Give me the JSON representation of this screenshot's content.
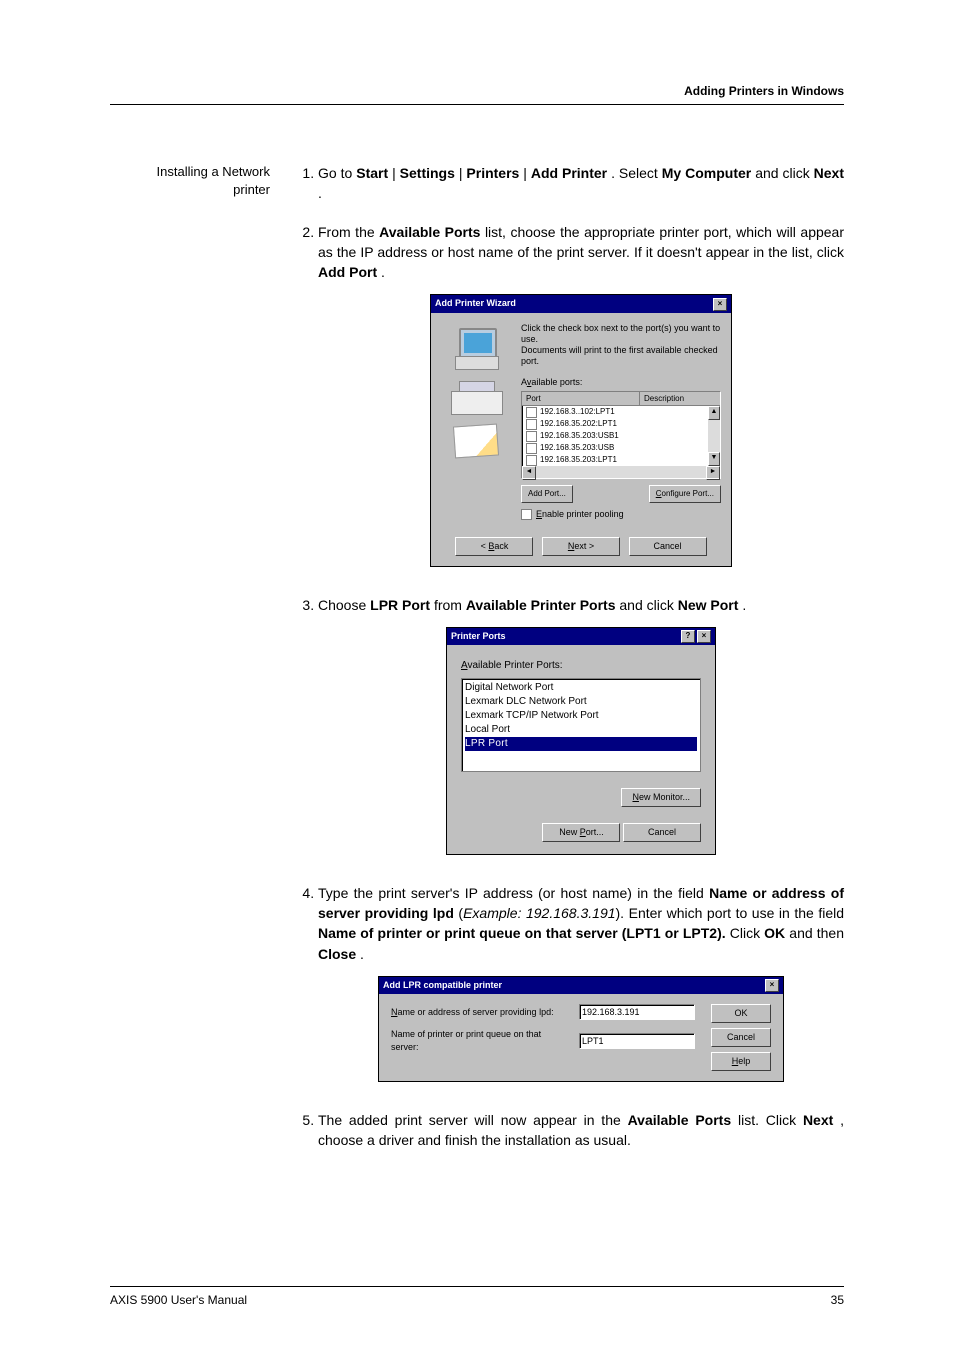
{
  "header": {
    "section_title": "Adding Printers in Windows"
  },
  "side": {
    "heading_line1": "Installing a Network",
    "heading_line2": "printer"
  },
  "steps": {
    "s1": {
      "pre": "Go to ",
      "b1": "Start",
      "sep": " | ",
      "b2": "Settings",
      "b3": "Printers",
      "b4": "Add Printer",
      "mid": ". Select ",
      "b5": "My Computer",
      "mid2": " and click ",
      "b6": "Next",
      "end": "."
    },
    "s2": {
      "pre": "From the ",
      "b1": "Available Ports",
      "mid": " list, choose the appropriate printer port, which will appear as the IP address or host name of the print server. If it doesn't appear in the list, click ",
      "b2": "Add Port",
      "end": "."
    },
    "s3": {
      "pre": "Choose ",
      "b1": "LPR Port",
      "mid": " from ",
      "b2": "Available Printer Ports",
      "mid2": " and click ",
      "b3": "New Port",
      "end": "."
    },
    "s4": {
      "pre": "Type the print server's IP address (or host name) in the field ",
      "b1": "Name or address of server providing lpd",
      "ex_open": " (",
      "ex": "Example: 192.168.3.191",
      "ex_close": "). ",
      "mid": "Enter which port to use in the field ",
      "b2": "Name of printer or print queue on that server (LPT1 or LPT2).",
      "mid2": " Click ",
      "b3": "OK",
      "mid3": " and then ",
      "b4": "Close",
      "end": "."
    },
    "s5": {
      "pre": "The added print server will now appear in the ",
      "b1": "Available Ports",
      "mid": " list. Click ",
      "b2": "Next",
      "end": ", choose a driver and finish the installation as usual."
    }
  },
  "dlg1": {
    "title": "Add Printer Wizard",
    "instr1": "Click the check box next to the port(s) you want to use.",
    "instr2": "Documents will print to the first available checked port.",
    "list_label_pre": "A",
    "list_label_u": "v",
    "list_label_post": "ailable ports:",
    "col_port": "Port",
    "col_desc": "Description",
    "ports": [
      "192.168.3..102:LPT1",
      "192.168.35.202:LPT1",
      "192.168.35.203:USB1",
      "192.168.35.203:USB",
      "192.168.35.203:LPT1"
    ],
    "btn_add": "Add Port...",
    "btn_cfg_pre": "",
    "btn_cfg_u": "C",
    "btn_cfg_post": "onfigure Port...",
    "pool_pre": "",
    "pool_u": "E",
    "pool_post": "nable printer pooling",
    "btn_back_pre": "< ",
    "btn_back_u": "B",
    "btn_back_post": "ack",
    "btn_next_pre": "",
    "btn_next_u": "N",
    "btn_next_post": "ext >",
    "btn_cancel": "Cancel"
  },
  "dlg2": {
    "title": "Printer Ports",
    "label_pre": "",
    "label_u": "A",
    "label_post": "vailable Printer Ports:",
    "items": [
      "Digital Network Port",
      "Lexmark DLC Network Port",
      "Lexmark TCP/IP Network Port",
      "Local Port",
      "LPR Port"
    ],
    "btn_newmon_pre": "",
    "btn_newmon_u": "N",
    "btn_newmon_post": "ew Monitor...",
    "btn_newport_pre": "New ",
    "btn_newport_u": "P",
    "btn_newport_post": "ort...",
    "btn_cancel": "Cancel"
  },
  "dlg3": {
    "title": "Add LPR compatible printer",
    "lbl1_pre": "",
    "lbl1_u": "N",
    "lbl1_post": "ame or address of server providing lpd:",
    "val1": "192.168.3.191",
    "lbl2_pre": "Name of printer or print queue on that server:",
    "val2": "LPT1",
    "btn_ok": "OK",
    "btn_cancel": "Cancel",
    "btn_help_pre": "",
    "btn_help_u": "H",
    "btn_help_post": "elp"
  },
  "footer": {
    "manual": "AXIS 5900 User's Manual",
    "page": "35"
  }
}
